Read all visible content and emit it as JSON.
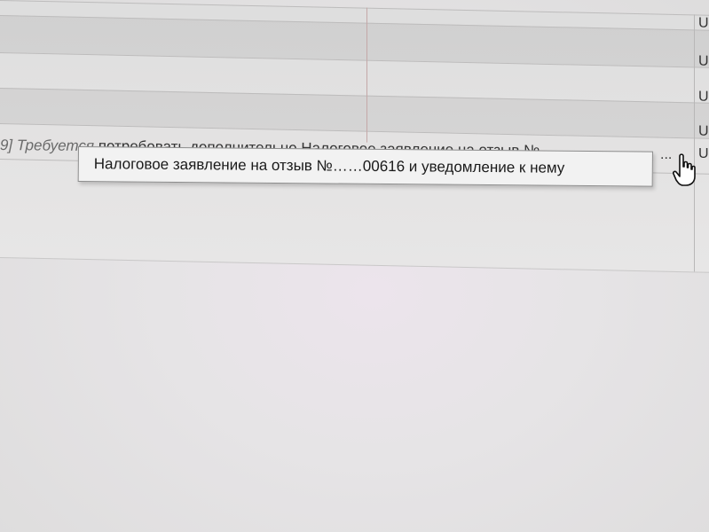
{
  "grid": {
    "cell_labels": [
      "U",
      "U",
      "U",
      "U",
      "U"
    ]
  },
  "row": {
    "prefix": "9] Требуется",
    "hidden_text": "потребовать дополнительно Налоговое заявление на отзыв №",
    "trailing_link": "...",
    "status": "U"
  },
  "tooltip": {
    "text": "Налоговое заявление на отзыв №……00616 и уведомление к нему"
  },
  "cursor": {
    "icon": "hand-pointer-icon"
  },
  "colors": {
    "background": "#e4e3e3",
    "tooltip_bg": "#f2f2f2",
    "tooltip_border": "#8c8c8c",
    "grid_line": "#bdbcbc",
    "column_divider": "#c4a8a8"
  }
}
